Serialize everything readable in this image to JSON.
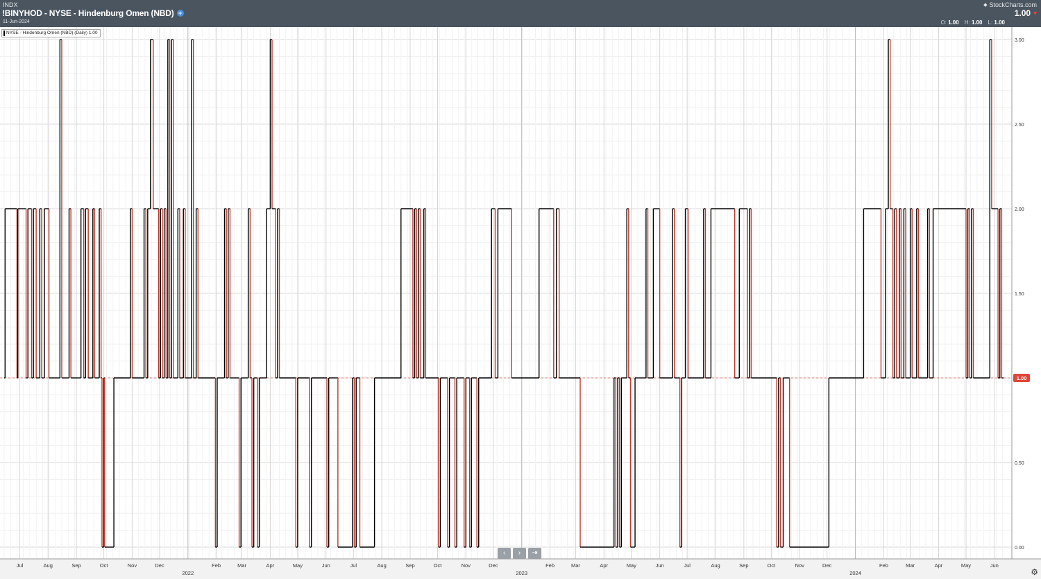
{
  "header": {
    "exchange": "INDX",
    "title": "!BINYHOD - NYSE - Hindenburg Omen (NBD)",
    "date": "11-Jun-2024",
    "brand": "StockCharts.com",
    "last": "1.00",
    "change": "",
    "ohlc": [
      {
        "label": "O:",
        "value": "1.00"
      },
      {
        "label": "H:",
        "value": "1.00"
      },
      {
        "label": "L:",
        "value": "1.00"
      }
    ]
  },
  "legend": {
    "label": "NYSE - Hindenburg Omen (NBD) (Daily) 1.00"
  },
  "controls": {
    "prev": "‹",
    "next": "›",
    "end": "⇥"
  },
  "colors": {
    "line": "#000000",
    "down": "#c0392b",
    "last_tag": "#e0453a",
    "header": "#4a5560"
  },
  "chart_data": {
    "type": "line",
    "title": "!BINYHOD - NYSE - Hindenburg Omen (NBD)",
    "series": [
      {
        "name": "NYSE - Hindenburg Omen (NBD) (Daily)"
      }
    ],
    "x_range": [
      "2021-06-14",
      "2024-06-11"
    ],
    "ylim": [
      0.0,
      3.0
    ],
    "y_ticks": [
      "3.00",
      "2.50",
      "2.00",
      "1.50",
      "1.00",
      "0.50",
      "0.00"
    ],
    "last_value": "1.00",
    "grid": true,
    "x_ticks": [
      {
        "date": "2021-07-01",
        "label": "Jul"
      },
      {
        "date": "2021-08-01",
        "label": "Aug"
      },
      {
        "date": "2021-09-01",
        "label": "Sep"
      },
      {
        "date": "2021-10-01",
        "label": "Oct"
      },
      {
        "date": "2021-11-01",
        "label": "Nov"
      },
      {
        "date": "2021-12-01",
        "label": "Dec"
      },
      {
        "date": "2022-02-01",
        "label": "Feb"
      },
      {
        "date": "2022-03-01",
        "label": "Mar"
      },
      {
        "date": "2022-04-01",
        "label": "Apr"
      },
      {
        "date": "2022-05-01",
        "label": "May"
      },
      {
        "date": "2022-06-01",
        "label": "Jun"
      },
      {
        "date": "2022-07-01",
        "label": "Jul"
      },
      {
        "date": "2022-08-01",
        "label": "Aug"
      },
      {
        "date": "2022-09-01",
        "label": "Sep"
      },
      {
        "date": "2022-10-01",
        "label": "Oct"
      },
      {
        "date": "2022-11-01",
        "label": "Nov"
      },
      {
        "date": "2022-12-01",
        "label": "Dec"
      },
      {
        "date": "2023-02-01",
        "label": "Feb"
      },
      {
        "date": "2023-03-01",
        "label": "Mar"
      },
      {
        "date": "2023-04-01",
        "label": "Apr"
      },
      {
        "date": "2023-05-01",
        "label": "May"
      },
      {
        "date": "2023-06-01",
        "label": "Jun"
      },
      {
        "date": "2023-07-01",
        "label": "Jul"
      },
      {
        "date": "2023-08-01",
        "label": "Aug"
      },
      {
        "date": "2023-09-01",
        "label": "Sep"
      },
      {
        "date": "2023-10-01",
        "label": "Oct"
      },
      {
        "date": "2023-11-01",
        "label": "Nov"
      },
      {
        "date": "2023-12-01",
        "label": "Dec"
      },
      {
        "date": "2024-02-01",
        "label": "Feb"
      },
      {
        "date": "2024-03-01",
        "label": "Mar"
      },
      {
        "date": "2024-04-01",
        "label": "Apr"
      },
      {
        "date": "2024-05-01",
        "label": "May"
      },
      {
        "date": "2024-06-01",
        "label": "Jun"
      }
    ],
    "year_labels": [
      {
        "date": "2022-01-01",
        "label": "2022"
      },
      {
        "date": "2023-01-01",
        "label": "2023"
      },
      {
        "date": "2024-01-01",
        "label": "2024"
      }
    ],
    "values": [
      {
        "date": "2021-06-14",
        "value": 1
      },
      {
        "date": "2021-06-15",
        "value": 2
      },
      {
        "date": "2021-06-28",
        "value": 1
      },
      {
        "date": "2021-06-29",
        "value": 2
      },
      {
        "date": "2021-07-08",
        "value": 1
      },
      {
        "date": "2021-07-10",
        "value": 2
      },
      {
        "date": "2021-07-14",
        "value": 1
      },
      {
        "date": "2021-07-16",
        "value": 2
      },
      {
        "date": "2021-07-19",
        "value": 1
      },
      {
        "date": "2021-07-23",
        "value": 2
      },
      {
        "date": "2021-07-25",
        "value": 1
      },
      {
        "date": "2021-07-28",
        "value": 2
      },
      {
        "date": "2021-08-02",
        "value": 1
      },
      {
        "date": "2021-08-14",
        "value": 3
      },
      {
        "date": "2021-08-16",
        "value": 1
      },
      {
        "date": "2021-08-24",
        "value": 2
      },
      {
        "date": "2021-08-26",
        "value": 1
      },
      {
        "date": "2021-09-06",
        "value": 2
      },
      {
        "date": "2021-09-09",
        "value": 1
      },
      {
        "date": "2021-09-11",
        "value": 2
      },
      {
        "date": "2021-09-14",
        "value": 1
      },
      {
        "date": "2021-09-19",
        "value": 2
      },
      {
        "date": "2021-09-21",
        "value": 1
      },
      {
        "date": "2021-09-26",
        "value": 2
      },
      {
        "date": "2021-09-28",
        "value": 1
      },
      {
        "date": "2021-09-29",
        "value": 0
      },
      {
        "date": "2021-10-01",
        "value": 1
      },
      {
        "date": "2021-10-02",
        "value": 0
      },
      {
        "date": "2021-10-12",
        "value": 1
      },
      {
        "date": "2021-10-30",
        "value": 2
      },
      {
        "date": "2021-11-01",
        "value": 1
      },
      {
        "date": "2021-11-14",
        "value": 2
      },
      {
        "date": "2021-11-16",
        "value": 1
      },
      {
        "date": "2021-11-18",
        "value": 2
      },
      {
        "date": "2021-11-21",
        "value": 3
      },
      {
        "date": "2021-11-24",
        "value": 2
      },
      {
        "date": "2021-11-30",
        "value": 1
      },
      {
        "date": "2021-12-02",
        "value": 2
      },
      {
        "date": "2021-12-04",
        "value": 1
      },
      {
        "date": "2021-12-06",
        "value": 2
      },
      {
        "date": "2021-12-08",
        "value": 1
      },
      {
        "date": "2021-12-10",
        "value": 3
      },
      {
        "date": "2021-12-12",
        "value": 1
      },
      {
        "date": "2021-12-14",
        "value": 3
      },
      {
        "date": "2021-12-16",
        "value": 1
      },
      {
        "date": "2021-12-21",
        "value": 2
      },
      {
        "date": "2021-12-23",
        "value": 1
      },
      {
        "date": "2021-12-27",
        "value": 2
      },
      {
        "date": "2021-12-29",
        "value": 1
      },
      {
        "date": "2022-01-05",
        "value": 3
      },
      {
        "date": "2022-01-07",
        "value": 1
      },
      {
        "date": "2022-01-10",
        "value": 2
      },
      {
        "date": "2022-01-12",
        "value": 1
      },
      {
        "date": "2022-01-31",
        "value": 0
      },
      {
        "date": "2022-02-02",
        "value": 1
      },
      {
        "date": "2022-02-10",
        "value": 2
      },
      {
        "date": "2022-02-12",
        "value": 1
      },
      {
        "date": "2022-02-14",
        "value": 2
      },
      {
        "date": "2022-02-16",
        "value": 1
      },
      {
        "date": "2022-02-26",
        "value": 0
      },
      {
        "date": "2022-02-28",
        "value": 1
      },
      {
        "date": "2022-03-08",
        "value": 2
      },
      {
        "date": "2022-03-10",
        "value": 1
      },
      {
        "date": "2022-03-12",
        "value": 0
      },
      {
        "date": "2022-03-14",
        "value": 1
      },
      {
        "date": "2022-03-18",
        "value": 0
      },
      {
        "date": "2022-03-20",
        "value": 1
      },
      {
        "date": "2022-03-28",
        "value": 2
      },
      {
        "date": "2022-04-01",
        "value": 3
      },
      {
        "date": "2022-04-03",
        "value": 2
      },
      {
        "date": "2022-04-07",
        "value": 1
      },
      {
        "date": "2022-04-09",
        "value": 2
      },
      {
        "date": "2022-04-11",
        "value": 1
      },
      {
        "date": "2022-04-29",
        "value": 0
      },
      {
        "date": "2022-05-01",
        "value": 1
      },
      {
        "date": "2022-05-14",
        "value": 0
      },
      {
        "date": "2022-05-16",
        "value": 1
      },
      {
        "date": "2022-06-02",
        "value": 0
      },
      {
        "date": "2022-06-04",
        "value": 1
      },
      {
        "date": "2022-06-14",
        "value": 0
      },
      {
        "date": "2022-06-30",
        "value": 1
      },
      {
        "date": "2022-07-02",
        "value": 0
      },
      {
        "date": "2022-07-04",
        "value": 1
      },
      {
        "date": "2022-07-08",
        "value": 0
      },
      {
        "date": "2022-07-24",
        "value": 1
      },
      {
        "date": "2022-08-22",
        "value": 2
      },
      {
        "date": "2022-09-04",
        "value": 1
      },
      {
        "date": "2022-09-06",
        "value": 2
      },
      {
        "date": "2022-09-08",
        "value": 1
      },
      {
        "date": "2022-09-10",
        "value": 2
      },
      {
        "date": "2022-09-12",
        "value": 1
      },
      {
        "date": "2022-09-16",
        "value": 2
      },
      {
        "date": "2022-09-18",
        "value": 1
      },
      {
        "date": "2022-10-02",
        "value": 0
      },
      {
        "date": "2022-10-04",
        "value": 1
      },
      {
        "date": "2022-10-12",
        "value": 0
      },
      {
        "date": "2022-10-14",
        "value": 1
      },
      {
        "date": "2022-10-20",
        "value": 0
      },
      {
        "date": "2022-10-22",
        "value": 1
      },
      {
        "date": "2022-10-30",
        "value": 0
      },
      {
        "date": "2022-11-01",
        "value": 1
      },
      {
        "date": "2022-11-05",
        "value": 0
      },
      {
        "date": "2022-11-07",
        "value": 1
      },
      {
        "date": "2022-11-13",
        "value": 0
      },
      {
        "date": "2022-11-15",
        "value": 1
      },
      {
        "date": "2022-11-29",
        "value": 2
      },
      {
        "date": "2022-12-03",
        "value": 1
      },
      {
        "date": "2022-12-06",
        "value": 2
      },
      {
        "date": "2022-12-21",
        "value": 1
      },
      {
        "date": "2023-01-20",
        "value": 2
      },
      {
        "date": "2023-02-05",
        "value": 1
      },
      {
        "date": "2023-02-08",
        "value": 2
      },
      {
        "date": "2023-02-11",
        "value": 1
      },
      {
        "date": "2023-03-06",
        "value": 0
      },
      {
        "date": "2023-04-12",
        "value": 1
      },
      {
        "date": "2023-04-14",
        "value": 0
      },
      {
        "date": "2023-04-16",
        "value": 1
      },
      {
        "date": "2023-04-18",
        "value": 0
      },
      {
        "date": "2023-04-20",
        "value": 1
      },
      {
        "date": "2023-04-26",
        "value": 2
      },
      {
        "date": "2023-04-28",
        "value": 1
      },
      {
        "date": "2023-04-30",
        "value": 0
      },
      {
        "date": "2023-05-05",
        "value": 1
      },
      {
        "date": "2023-05-17",
        "value": 2
      },
      {
        "date": "2023-05-19",
        "value": 1
      },
      {
        "date": "2023-05-25",
        "value": 2
      },
      {
        "date": "2023-06-01",
        "value": 1
      },
      {
        "date": "2023-06-15",
        "value": 2
      },
      {
        "date": "2023-06-17",
        "value": 1
      },
      {
        "date": "2023-06-23",
        "value": 0
      },
      {
        "date": "2023-06-25",
        "value": 1
      },
      {
        "date": "2023-06-29",
        "value": 2
      },
      {
        "date": "2023-07-02",
        "value": 1
      },
      {
        "date": "2023-07-19",
        "value": 2
      },
      {
        "date": "2023-07-21",
        "value": 1
      },
      {
        "date": "2023-07-27",
        "value": 2
      },
      {
        "date": "2023-08-22",
        "value": 1
      },
      {
        "date": "2023-08-27",
        "value": 2
      },
      {
        "date": "2023-09-05",
        "value": 1
      },
      {
        "date": "2023-09-07",
        "value": 2
      },
      {
        "date": "2023-09-09",
        "value": 1
      },
      {
        "date": "2023-10-07",
        "value": 0
      },
      {
        "date": "2023-10-09",
        "value": 1
      },
      {
        "date": "2023-10-11",
        "value": 0
      },
      {
        "date": "2023-10-14",
        "value": 1
      },
      {
        "date": "2023-10-21",
        "value": 0
      },
      {
        "date": "2023-12-03",
        "value": 1
      },
      {
        "date": "2024-01-10",
        "value": 2
      },
      {
        "date": "2024-01-29",
        "value": 1
      },
      {
        "date": "2024-02-03",
        "value": 2
      },
      {
        "date": "2024-02-06",
        "value": 3
      },
      {
        "date": "2024-02-08",
        "value": 2
      },
      {
        "date": "2024-02-11",
        "value": 1
      },
      {
        "date": "2024-02-13",
        "value": 2
      },
      {
        "date": "2024-02-15",
        "value": 1
      },
      {
        "date": "2024-02-18",
        "value": 2
      },
      {
        "date": "2024-02-20",
        "value": 1
      },
      {
        "date": "2024-02-23",
        "value": 2
      },
      {
        "date": "2024-02-25",
        "value": 1
      },
      {
        "date": "2024-03-01",
        "value": 2
      },
      {
        "date": "2024-03-03",
        "value": 1
      },
      {
        "date": "2024-03-08",
        "value": 2
      },
      {
        "date": "2024-03-10",
        "value": 1
      },
      {
        "date": "2024-03-20",
        "value": 2
      },
      {
        "date": "2024-03-22",
        "value": 1
      },
      {
        "date": "2024-03-26",
        "value": 2
      },
      {
        "date": "2024-05-01",
        "value": 1
      },
      {
        "date": "2024-05-03",
        "value": 2
      },
      {
        "date": "2024-05-05",
        "value": 1
      },
      {
        "date": "2024-05-07",
        "value": 2
      },
      {
        "date": "2024-05-09",
        "value": 1
      },
      {
        "date": "2024-05-27",
        "value": 3
      },
      {
        "date": "2024-05-29",
        "value": 2
      },
      {
        "date": "2024-06-05",
        "value": 1
      },
      {
        "date": "2024-06-07",
        "value": 2
      },
      {
        "date": "2024-06-09",
        "value": 1
      },
      {
        "date": "2024-06-11",
        "value": 1
      }
    ]
  }
}
